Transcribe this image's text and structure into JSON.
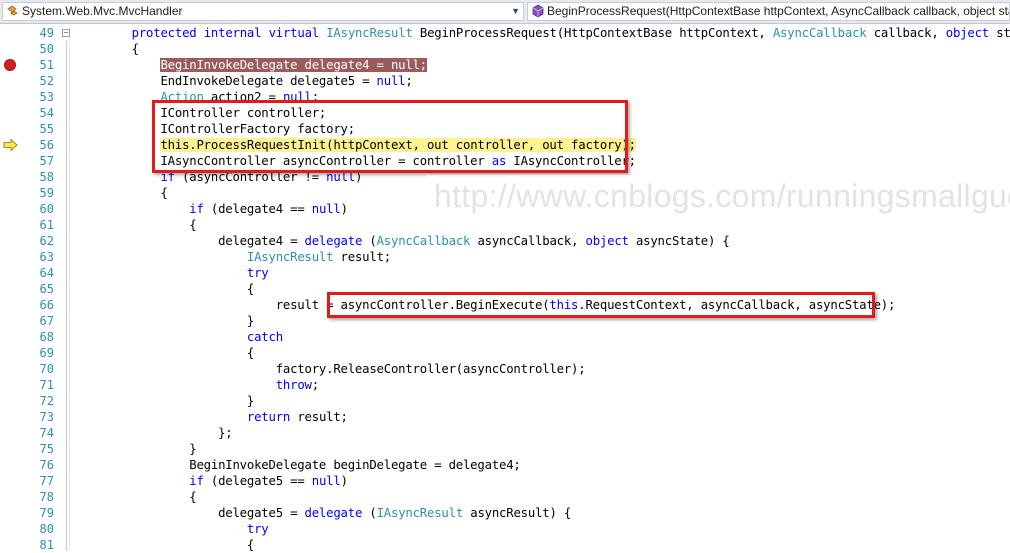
{
  "navbar": {
    "class_combo": "System.Web.Mvc.MvcHandler",
    "member_combo": "BeginProcessRequest(HttpContextBase httpContext, AsyncCallback callback, object state)"
  },
  "watermark": "http://www.cnblogs.com/runningsmallguo/",
  "lines": [
    {
      "n": "49",
      "tokens": [
        [
          "        ",
          ""
        ],
        [
          "protected",
          "k"
        ],
        [
          " ",
          ""
        ],
        [
          "internal",
          "k"
        ],
        [
          " ",
          ""
        ],
        [
          "virtual",
          "k"
        ],
        [
          " ",
          ""
        ],
        [
          "IAsyncResult",
          "t"
        ],
        [
          " BeginProcessRequest(HttpContextBase httpContext, ",
          ""
        ],
        [
          "AsyncCallback",
          "t"
        ],
        [
          " callback, ",
          ""
        ],
        [
          "object",
          "k"
        ],
        [
          " state)",
          ""
        ]
      ]
    },
    {
      "n": "50",
      "tokens": [
        [
          "        {",
          ""
        ]
      ]
    },
    {
      "n": "51",
      "tokens": [
        [
          "            ",
          ""
        ],
        [
          "BeginInvokeDelegate delegate4 = null;",
          "bp"
        ]
      ]
    },
    {
      "n": "52",
      "tokens": [
        [
          "            EndInvokeDelegate delegate5 = ",
          ""
        ],
        [
          "null",
          "k"
        ],
        [
          ";",
          ""
        ]
      ]
    },
    {
      "n": "53",
      "tokens": [
        [
          "            ",
          ""
        ],
        [
          "Action",
          "t"
        ],
        [
          " action2 = ",
          ""
        ],
        [
          "null",
          "k"
        ],
        [
          ";",
          ""
        ]
      ]
    },
    {
      "n": "54",
      "tokens": [
        [
          "            IController controller;",
          ""
        ]
      ]
    },
    {
      "n": "55",
      "tokens": [
        [
          "            IControllerFactory factory;",
          ""
        ]
      ]
    },
    {
      "n": "56",
      "tokens": [
        [
          "            ",
          ""
        ],
        [
          "this.ProcessRequestInit(httpContext, out controller, out factory);",
          "cur"
        ]
      ]
    },
    {
      "n": "57",
      "tokens": [
        [
          "            IAsyncController asyncController = controller ",
          ""
        ],
        [
          "as",
          "k"
        ],
        [
          " IAsyncController;",
          ""
        ]
      ]
    },
    {
      "n": "58",
      "tokens": [
        [
          "            ",
          ""
        ],
        [
          "if",
          "k"
        ],
        [
          " (asyncController != ",
          ""
        ],
        [
          "null",
          "k"
        ],
        [
          ")",
          ""
        ]
      ]
    },
    {
      "n": "59",
      "tokens": [
        [
          "            {",
          ""
        ]
      ]
    },
    {
      "n": "60",
      "tokens": [
        [
          "                ",
          ""
        ],
        [
          "if",
          "k"
        ],
        [
          " (delegate4 == ",
          ""
        ],
        [
          "null",
          "k"
        ],
        [
          ")",
          ""
        ]
      ]
    },
    {
      "n": "61",
      "tokens": [
        [
          "                {",
          ""
        ]
      ]
    },
    {
      "n": "62",
      "tokens": [
        [
          "                    delegate4 = ",
          ""
        ],
        [
          "delegate",
          "k"
        ],
        [
          " (",
          ""
        ],
        [
          "AsyncCallback",
          "t"
        ],
        [
          " asyncCallback, ",
          ""
        ],
        [
          "object",
          "k"
        ],
        [
          " asyncState) {",
          ""
        ]
      ]
    },
    {
      "n": "63",
      "tokens": [
        [
          "                        ",
          ""
        ],
        [
          "IAsyncResult",
          "t"
        ],
        [
          " result;",
          ""
        ]
      ]
    },
    {
      "n": "64",
      "tokens": [
        [
          "                        ",
          ""
        ],
        [
          "try",
          "k"
        ]
      ]
    },
    {
      "n": "65",
      "tokens": [
        [
          "                        {",
          ""
        ]
      ]
    },
    {
      "n": "66",
      "tokens": [
        [
          "                            result = asyncController.BeginExecute(",
          ""
        ],
        [
          "this",
          "k"
        ],
        [
          ".RequestContext, asyncCallback, asyncState);",
          ""
        ]
      ]
    },
    {
      "n": "67",
      "tokens": [
        [
          "                        }",
          ""
        ]
      ]
    },
    {
      "n": "68",
      "tokens": [
        [
          "                        ",
          ""
        ],
        [
          "catch",
          "k"
        ]
      ]
    },
    {
      "n": "69",
      "tokens": [
        [
          "                        {",
          ""
        ]
      ]
    },
    {
      "n": "70",
      "tokens": [
        [
          "                            factory.ReleaseController(asyncController);",
          ""
        ]
      ]
    },
    {
      "n": "71",
      "tokens": [
        [
          "                            ",
          ""
        ],
        [
          "throw",
          "k"
        ],
        [
          ";",
          ""
        ]
      ]
    },
    {
      "n": "72",
      "tokens": [
        [
          "                        }",
          ""
        ]
      ]
    },
    {
      "n": "73",
      "tokens": [
        [
          "                        ",
          ""
        ],
        [
          "return",
          "k"
        ],
        [
          " result;",
          ""
        ]
      ]
    },
    {
      "n": "74",
      "tokens": [
        [
          "                    };",
          ""
        ]
      ]
    },
    {
      "n": "75",
      "tokens": [
        [
          "                }",
          ""
        ]
      ]
    },
    {
      "n": "76",
      "tokens": [
        [
          "                BeginInvokeDelegate beginDelegate = delegate4;",
          ""
        ]
      ]
    },
    {
      "n": "77",
      "tokens": [
        [
          "                ",
          ""
        ],
        [
          "if",
          "k"
        ],
        [
          " (delegate5 == ",
          ""
        ],
        [
          "null",
          "k"
        ],
        [
          ")",
          ""
        ]
      ]
    },
    {
      "n": "78",
      "tokens": [
        [
          "                {",
          ""
        ]
      ]
    },
    {
      "n": "79",
      "tokens": [
        [
          "                    delegate5 = ",
          ""
        ],
        [
          "delegate",
          "k"
        ],
        [
          " (",
          ""
        ],
        [
          "IAsyncResult",
          "t"
        ],
        [
          " asyncResult) {",
          ""
        ]
      ]
    },
    {
      "n": "80",
      "tokens": [
        [
          "                        ",
          ""
        ],
        [
          "try",
          "k"
        ]
      ]
    },
    {
      "n": "81",
      "tokens": [
        [
          "                        {",
          ""
        ]
      ]
    }
  ],
  "breakpoint_line": "51",
  "current_line": "56",
  "colors": {
    "keyword": "#0000ff",
    "type": "#2b91af",
    "annotation": "#e21a1a"
  }
}
